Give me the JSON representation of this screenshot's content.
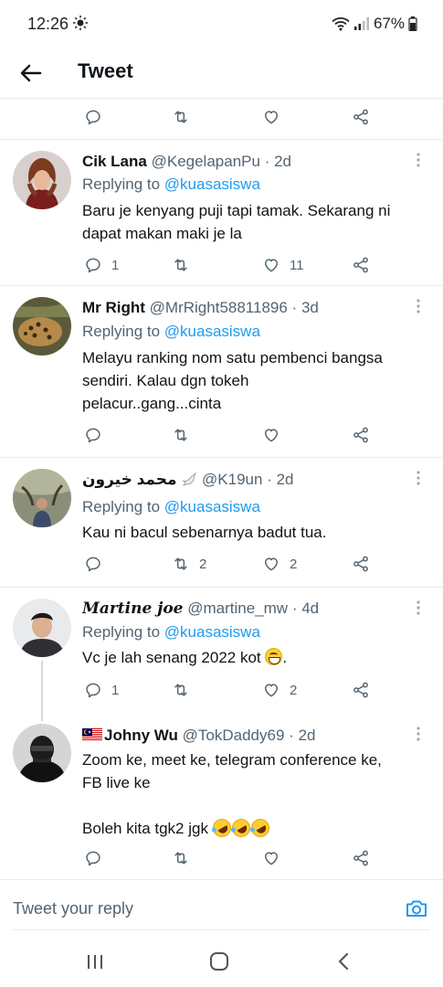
{
  "status_bar": {
    "time": "12:26",
    "battery": "67%"
  },
  "header": {
    "title": "Tweet"
  },
  "top_actions": {
    "reply_count": "",
    "retweet_count": "",
    "like_count": ""
  },
  "tweets": [
    {
      "name": "Cik Lana",
      "handle": "@KegelapanPu",
      "dot": "·",
      "time": "2d",
      "replying_prefix": "Replying to ",
      "replying_to": "@kuasasiswa",
      "body_lines": [
        "Baru je kenyang puji tapi tamak. Sekarang ni",
        "dapat makan maki je la"
      ],
      "reply_count": "1",
      "retweet_count": "",
      "like_count": "11"
    },
    {
      "name": "Mr Right",
      "handle": "@MrRight58811896",
      "dot": "·",
      "time": "3d",
      "replying_prefix": "Replying to ",
      "replying_to": "@kuasasiswa",
      "body_lines": [
        "Melayu ranking nom satu pembenci bangsa",
        "sendiri. Kalau dgn tokeh",
        "pelacur..gang...cinta"
      ],
      "reply_count": "",
      "retweet_count": "",
      "like_count": ""
    },
    {
      "name": "محمد خيرون",
      "handle": "@K19un",
      "dot": "·",
      "time": "2d",
      "replying_prefix": "Replying to ",
      "replying_to": "@kuasasiswa",
      "body_lines": [
        "Kau ni bacul sebenarnya badut tua."
      ],
      "reply_count": "",
      "retweet_count": "2",
      "like_count": "2"
    },
    {
      "name": "Martine joe",
      "handle": "@martine_mw",
      "dot": "·",
      "time": "4d",
      "replying_prefix": "Replying to ",
      "replying_to": "@kuasasiswa",
      "body_text": "Vc je lah senang 2022 kot",
      "body_suffix": ".",
      "reply_count": "1",
      "retweet_count": "",
      "like_count": "2"
    },
    {
      "name": "Johny Wu",
      "handle": "@TokDaddy69",
      "dot": "·",
      "time": "2d",
      "body_lines": [
        "Zoom ke, meet ke, telegram conference ke,",
        "FB live ke"
      ],
      "body_extra": "Boleh kita tgk2 jgk",
      "reply_count": "",
      "retweet_count": "",
      "like_count": ""
    }
  ],
  "reply_bar": {
    "placeholder": "Tweet your reply"
  },
  "colors": {
    "accent": "#1d9bf0",
    "text": "#0f1419",
    "secondary": "#536471",
    "divider": "#e6ecf0"
  },
  "icons": [
    "back-arrow-icon",
    "reply-icon",
    "retweet-icon",
    "like-icon",
    "share-icon",
    "more-icon",
    "camera-icon",
    "recent-apps-icon",
    "home-icon",
    "nav-back-icon"
  ]
}
